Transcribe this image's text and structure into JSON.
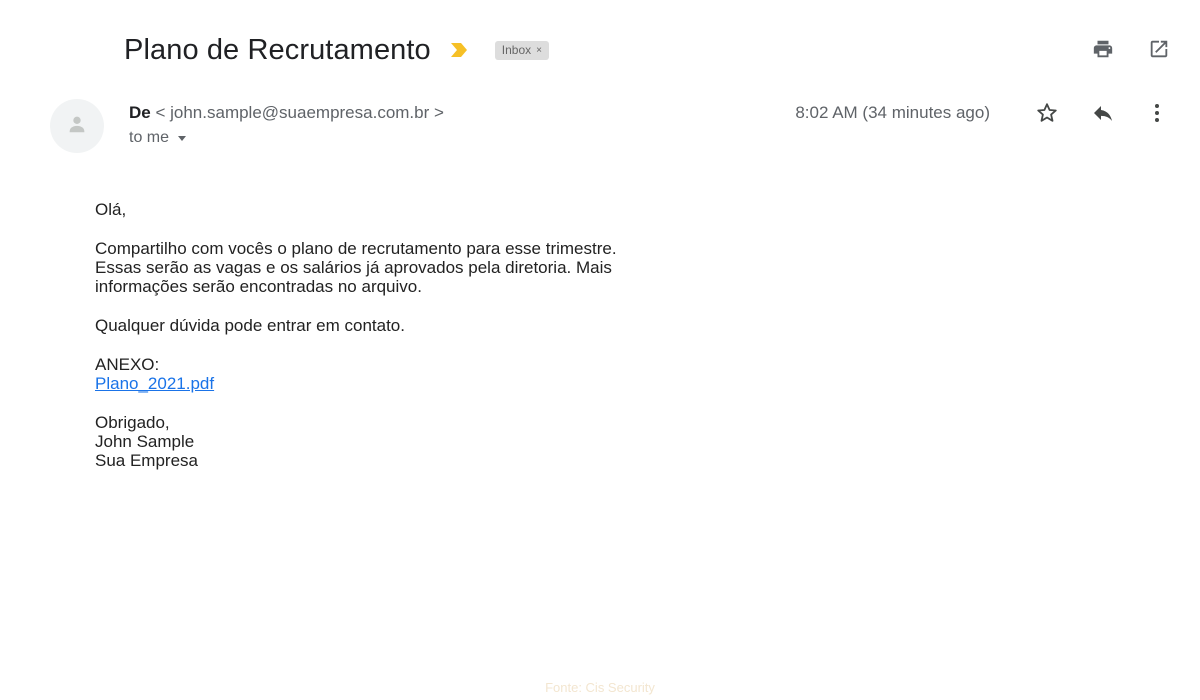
{
  "email": {
    "subject": "Plano de Recrutamento",
    "label_chip": "Inbox",
    "label_chip_close": "×",
    "sender_name": "De",
    "sender_email": "< john.sample@suaempresa.com.br >",
    "recipient_line": "to me",
    "timestamp": "8:02 AM (34 minutes ago)"
  },
  "icons": {
    "importance": "importance-marker-icon",
    "print": "print-icon",
    "open_new_window": "open-in-new-window-icon",
    "avatar": "person-avatar-icon",
    "star": "star-icon",
    "reply": "reply-icon",
    "more": "more-options-icon"
  },
  "colors": {
    "importance": "#f6c026",
    "link": "#1a73e8",
    "chip_bg": "#dddddd",
    "muted_text": "#5f6368"
  },
  "body": {
    "greeting": "Olá,",
    "paragraph1_line1": "Compartilho com vocês o plano de recrutamento para esse trimestre.",
    "paragraph1_line2": "Essas serão as vagas e os salários já aprovados pela diretoria. Mais",
    "paragraph1_line3": "informações serão encontradas no arquivo.",
    "paragraph2": "Qualquer dúvida pode entrar em contato.",
    "attachment_label": "ANEXO:",
    "attachment_link": "Plano_2021.pdf",
    "signoff": "Obrigado,",
    "signature_name": "John Sample",
    "signature_company": "Sua Empresa"
  },
  "footer": {
    "source": "Fonte: Cis Security"
  }
}
